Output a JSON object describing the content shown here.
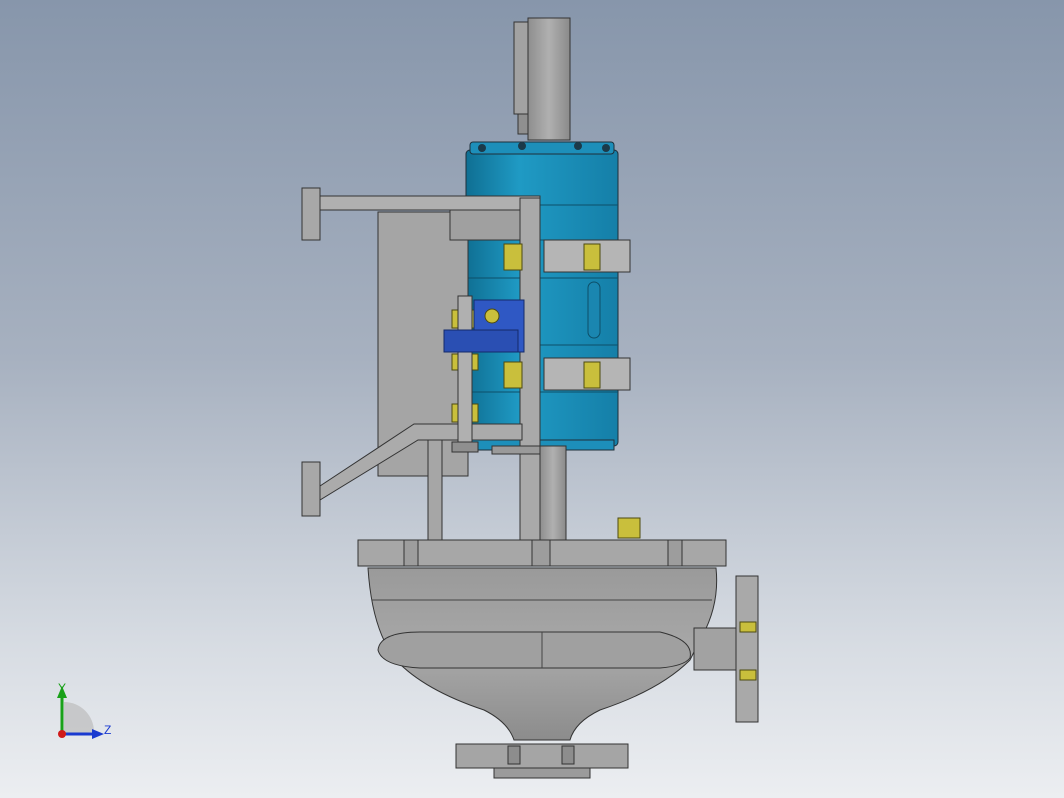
{
  "colors": {
    "background_top": "#8796ab",
    "background_bottom": "#eceef1",
    "steel": "#a3a3a3",
    "steel_dark": "#7e7e7e",
    "actuator_blue": "#1a8fb8",
    "bracket_blue": "#2f58c4",
    "brass": "#c9bf3c",
    "axis_x": "#d01a1a",
    "axis_y": "#19a119",
    "axis_z": "#1a3ad0"
  },
  "triad": {
    "y_label": "Y",
    "z_label": "Z",
    "icon": "coordinate-triad-icon"
  }
}
